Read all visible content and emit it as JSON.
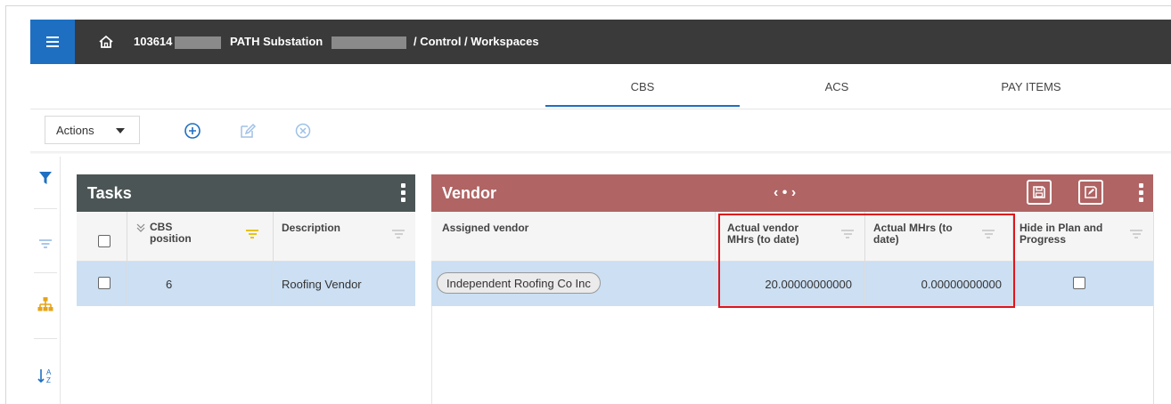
{
  "breadcrumb": {
    "project_id": "103614 |",
    "project_name": "PATH Substation",
    "path": "/ Control / Workspaces"
  },
  "tabs": [
    {
      "label": "CBS",
      "active": true
    },
    {
      "label": "ACS",
      "active": false
    },
    {
      "label": "PAY ITEMS",
      "active": false
    }
  ],
  "toolbar": {
    "actions_label": "Actions",
    "add_icon": "plus-circle-icon",
    "edit_icon": "edit-icon",
    "delete_icon": "x-circle-icon"
  },
  "tasks": {
    "title": "Tasks",
    "columns": {
      "cbs_position": "CBS position",
      "description": "Description"
    },
    "rows": [
      {
        "cbs_position": "6",
        "description": "Roofing Vendor"
      }
    ]
  },
  "vendor": {
    "title": "Vendor",
    "nav": "‹ • ›",
    "columns": {
      "assigned_vendor": "Assigned vendor",
      "actual_vendor_mhrs": "Actual vendor MHrs (to date)",
      "actual_mhrs": "Actual MHrs (to date)",
      "hide_in_plan": "Hide in Plan and Progress"
    },
    "rows": [
      {
        "assigned_vendor": "Independent Roofing Co Inc",
        "actual_vendor_mhrs": "20.00000000000",
        "actual_mhrs": "0.00000000000",
        "hide_in_plan": false
      }
    ]
  },
  "colors": {
    "topbar": "#3a3a3a",
    "menu_button": "#1e6fc2",
    "tasks_header": "#4c5555",
    "vendor_header": "#b06464",
    "selected_row": "#ccdff3",
    "highlight": "#e0141c"
  }
}
